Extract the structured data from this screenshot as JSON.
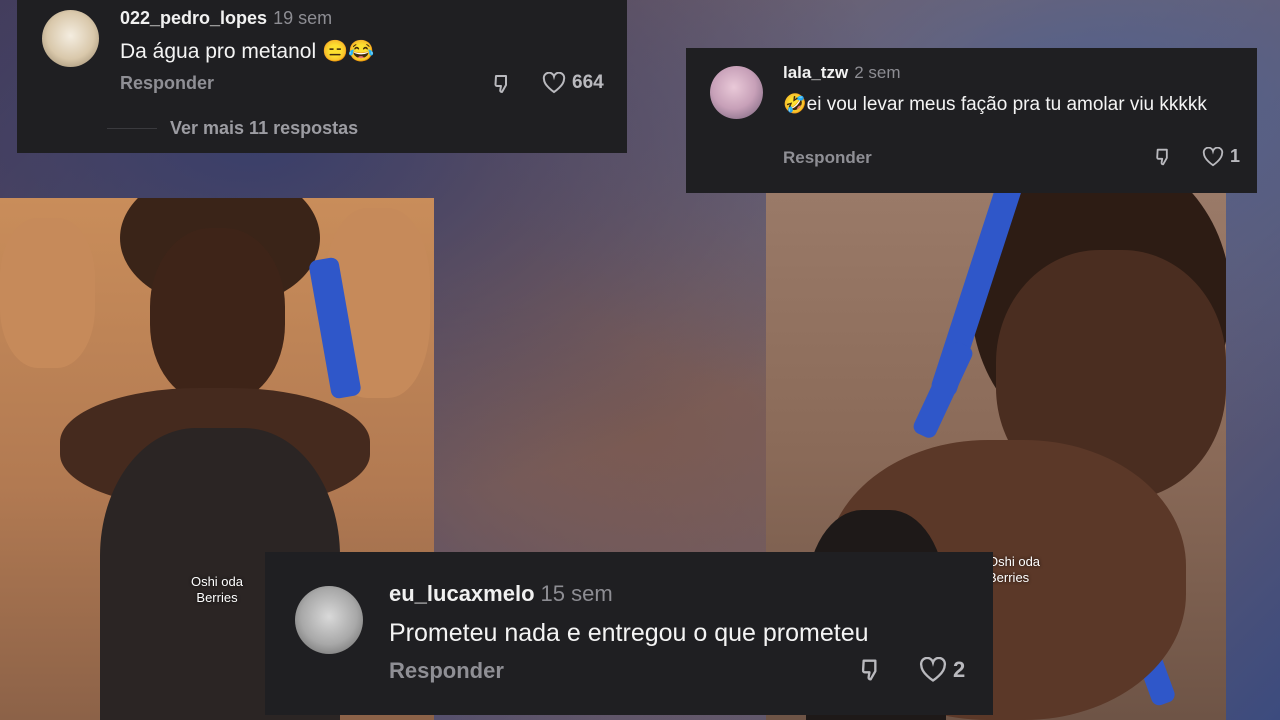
{
  "comments": [
    {
      "username": "022_pedro_lopes",
      "time": "19 sem",
      "text": "Da água pro metanol 😑😂",
      "reply": "Responder",
      "likes": "664",
      "more": "Ver mais 11 respostas"
    },
    {
      "username": "lala_tzw",
      "time": "2 sem",
      "text": "🤣ei vou levar meus fação pra tu amolar viu kkkkk",
      "reply": "Responder",
      "likes": "1"
    },
    {
      "username": "eu_lucaxmelo",
      "time": "15 sem",
      "text": "Prometeu nada e entregou o que prometeu",
      "reply": "Responder",
      "likes": "2"
    }
  ],
  "watermarks": {
    "left": [
      "Oshi oda",
      "Berries"
    ],
    "right": [
      "Oshi oda",
      "Berries"
    ]
  },
  "colors": {
    "card_bg": "#1f1f22",
    "braid": "#2f57c9"
  },
  "icons": [
    "dislike-icon",
    "heart-icon"
  ]
}
